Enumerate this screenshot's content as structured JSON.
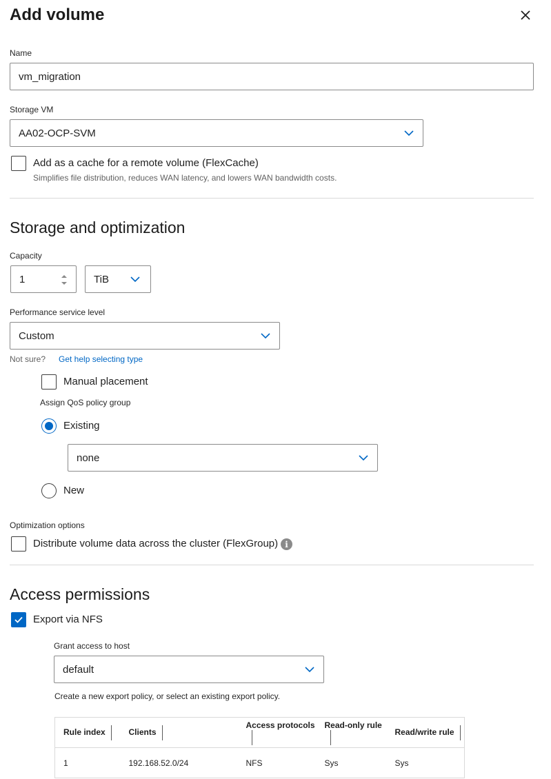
{
  "header": {
    "title": "Add volume"
  },
  "name": {
    "label": "Name",
    "value": "vm_migration"
  },
  "storage_vm": {
    "label": "Storage VM",
    "value": "AA02-OCP-SVM"
  },
  "flexcache": {
    "label": "Add as a cache for a remote volume (FlexCache)",
    "description": "Simplifies file distribution, reduces WAN latency, and lowers WAN bandwidth costs.",
    "checked": false
  },
  "storage_section": {
    "title": "Storage and optimization",
    "capacity_label": "Capacity",
    "capacity_value": "1",
    "capacity_unit": "TiB",
    "perf_label": "Performance service level",
    "perf_value": "Custom",
    "not_sure": "Not sure?",
    "help_link": "Get help selecting type",
    "manual_placement": "Manual placement",
    "qos_label": "Assign QoS policy group",
    "qos_existing": "Existing",
    "qos_existing_value": "none",
    "qos_new": "New",
    "opt_label": "Optimization options",
    "flexgroup": "Distribute volume data across the cluster (FlexGroup)"
  },
  "access_section": {
    "title": "Access permissions",
    "export_nfs": "Export via NFS",
    "export_nfs_checked": true,
    "grant_label": "Grant access to host",
    "grant_value": "default",
    "hint": "Create a new export policy, or select an existing export policy.",
    "table": {
      "headers": [
        "Rule index",
        "Clients",
        "Access protocols",
        "Read-only rule",
        "Read/write rule"
      ],
      "rows": [
        [
          "1",
          "192.168.52.0/24",
          "NFS",
          "Sys",
          "Sys"
        ]
      ]
    }
  },
  "colors": {
    "accent": "#0067c5",
    "border": "#8a8a8a",
    "divider": "#d9d9d9"
  }
}
